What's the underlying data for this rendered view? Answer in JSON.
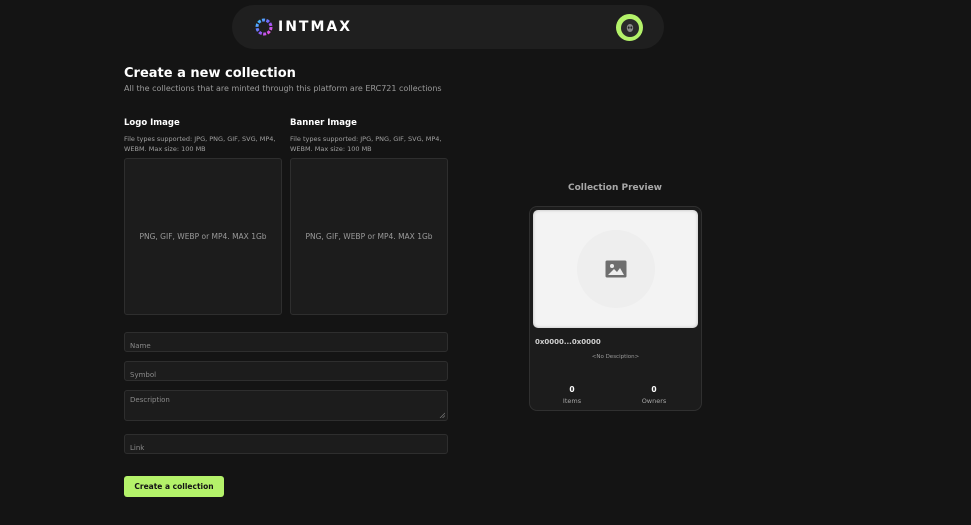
{
  "header": {
    "brand": "INTMAX",
    "logo_icon": "intmax-logo-icon",
    "avatar_icon": "alien-avatar-icon",
    "accent": "#b4f26a"
  },
  "page": {
    "title": "Create a new collection",
    "subtitle": "All the collections that are minted through this platform are ERC721 collections"
  },
  "logo_upload": {
    "label": "Logo Image",
    "hint": "File types supported: JPG, PNG, GIF, SVG, MP4, WEBM. Max size: 100 MB",
    "drop_text": "PNG, GIF, WEBP or MP4. MAX 1Gb"
  },
  "banner_upload": {
    "label": "Banner Image",
    "hint": "File types supported: JPG, PNG, GIF, SVG, MP4, WEBM. Max size: 100 MB",
    "drop_text": "PNG, GIF, WEBP or MP4. MAX 1Gb"
  },
  "form": {
    "name_placeholder": "Name",
    "symbol_placeholder": "Symbol",
    "description_placeholder": "Description",
    "link_placeholder": "Link",
    "submit_label": "Create a collection"
  },
  "preview": {
    "title": "Collection Preview",
    "image_icon": "image-placeholder-icon",
    "address": "0x0000...0x0000",
    "description": "<No Desciption>",
    "items_value": "0",
    "items_label": "Items",
    "owners_value": "0",
    "owners_label": "Owners"
  }
}
